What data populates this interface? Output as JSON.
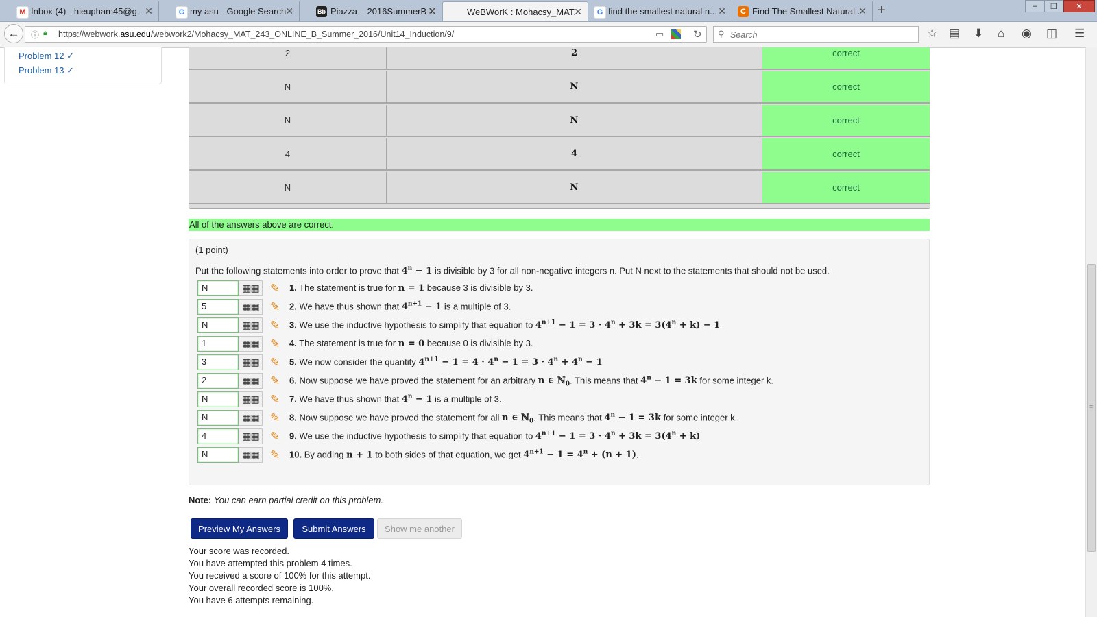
{
  "browser": {
    "tabs": [
      {
        "title": "Inbox (4) - hieupham45@g...",
        "favicon": "gmail-icon",
        "color": "#d93025",
        "glyph": "M"
      },
      {
        "title": "my asu - Google Search",
        "favicon": "google-icon",
        "color": "#4285f4",
        "glyph": "G"
      },
      {
        "title": "Piazza – 2016SummerB-X-...",
        "favicon": "blackboard-icon",
        "color": "#333333",
        "glyph": "Bb"
      },
      {
        "title": "WeBWorK : Mohacsy_MAT...",
        "favicon": "",
        "color": "",
        "glyph": ""
      },
      {
        "title": "find the smallest natural n...",
        "favicon": "google-icon",
        "color": "#4285f4",
        "glyph": "G"
      },
      {
        "title": "Find The Smallest Natural ...",
        "favicon": "chegg-icon",
        "color": "#eb7100",
        "glyph": "C"
      }
    ],
    "active_tab": 3,
    "url_prefix": "https://webwork.",
    "url_domain": "asu.edu",
    "url_path": "/webwork2/Mohacsy_MAT_243_ONLINE_B_Summer_2016/Unit14_Induction/9/",
    "search_placeholder": "Search"
  },
  "sidebar": {
    "items": [
      {
        "label": "Problem 12 ✓"
      },
      {
        "label": "Problem 13 ✓"
      }
    ]
  },
  "results": {
    "rows": [
      {
        "entered": "2",
        "preview": "2",
        "result": "correct"
      },
      {
        "entered": "N",
        "preview": "N",
        "result": "correct"
      },
      {
        "entered": "N",
        "preview": "N",
        "result": "correct"
      },
      {
        "entered": "4",
        "preview": "4",
        "result": "correct"
      },
      {
        "entered": "N",
        "preview": "N",
        "result": "correct"
      }
    ],
    "summary": "All of the answers above are correct."
  },
  "problem": {
    "points": "(1 point)",
    "statement_pre": "Put the following statements into order to prove that ",
    "statement_post": " is divisible by 3 for all non-negative integers n. Put N next to the statements that should not be used.",
    "items": [
      {
        "answer": "N",
        "num": "1."
      },
      {
        "answer": "5",
        "num": "2."
      },
      {
        "answer": "N",
        "num": "3."
      },
      {
        "answer": "1",
        "num": "4."
      },
      {
        "answer": "3",
        "num": "5."
      },
      {
        "answer": "2",
        "num": "6."
      },
      {
        "answer": "N",
        "num": "7."
      },
      {
        "answer": "N",
        "num": "8."
      },
      {
        "answer": "4",
        "num": "9."
      },
      {
        "answer": "N",
        "num": "10."
      }
    ]
  },
  "note": {
    "label": "Note:",
    "text": "You can earn partial credit on this problem."
  },
  "buttons": {
    "preview": "Preview My Answers",
    "submit": "Submit Answers",
    "another": "Show me another"
  },
  "score": {
    "lines": [
      "Your score was recorded.",
      "You have attempted this problem 4 times.",
      "You received a score of 100% for this attempt.",
      "Your overall recorded score is 100%.",
      "You have 6 attempts remaining."
    ]
  },
  "colors": {
    "correct_bg": "#8efd8e",
    "button_primary": "#0e2a86",
    "link": "#1f5fa8"
  }
}
